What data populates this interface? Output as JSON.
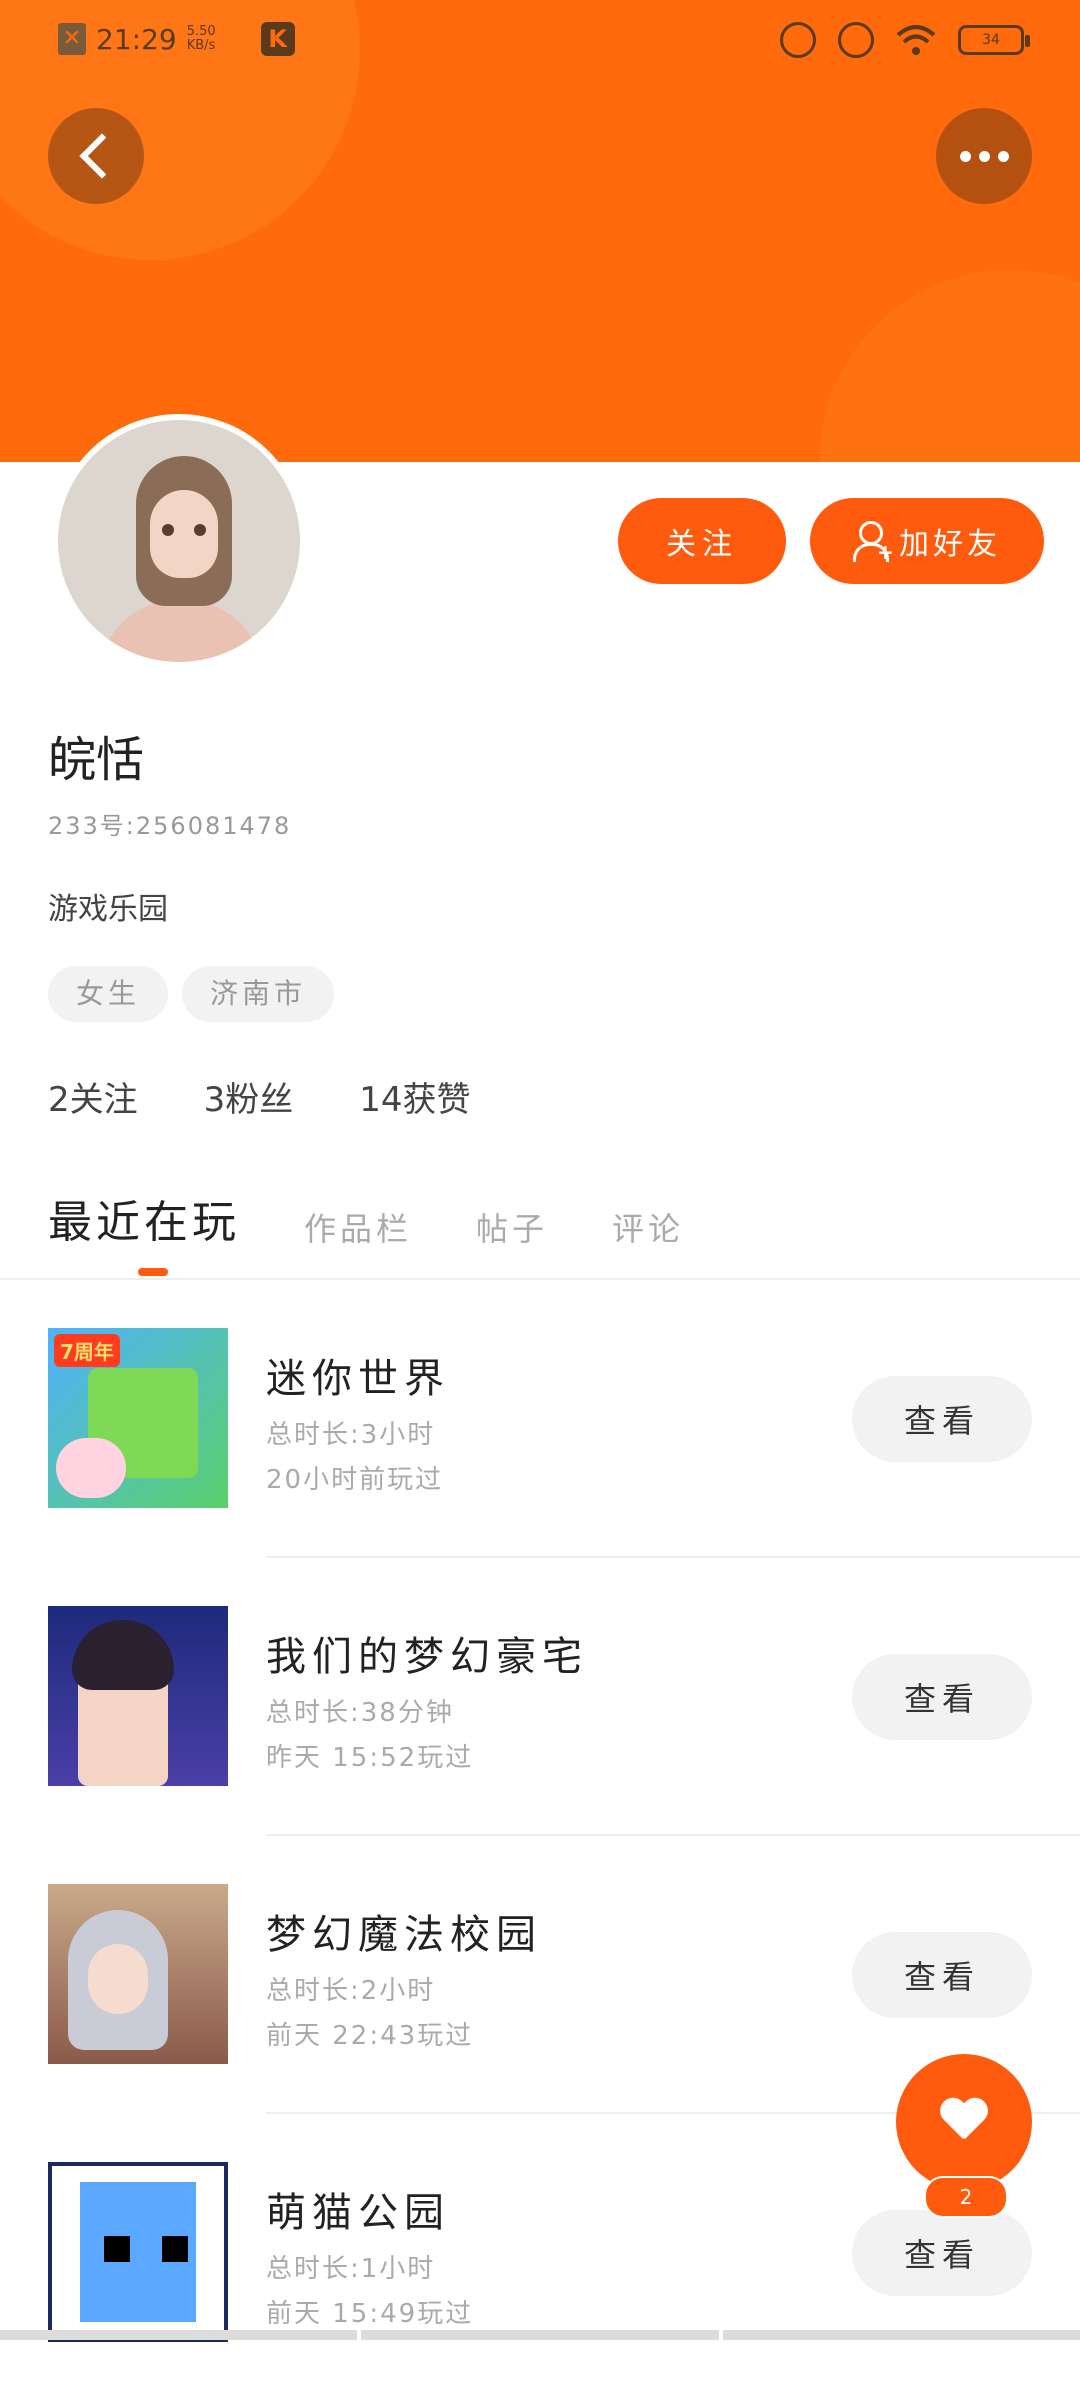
{
  "statusbar": {
    "time": "21:29",
    "speed": "5.50 KB/s",
    "battery": "34"
  },
  "profile": {
    "name": "皖恬",
    "uid": "233号:256081478",
    "bio": "游戏乐园",
    "tags": [
      "女生",
      "济南市"
    ],
    "stats": {
      "following": "2关注",
      "fans": "3粉丝",
      "likes": "14获赞"
    }
  },
  "actions": {
    "follow": "关注",
    "add_friend": "加好友"
  },
  "tabs": [
    "最近在玩",
    "作品栏",
    "帖子",
    "评论"
  ],
  "games": [
    {
      "name": "迷你世界",
      "duration": "总时长:3小时",
      "last_played": "20小时前玩过",
      "button": "查看"
    },
    {
      "name": "我们的梦幻豪宅",
      "duration": "总时长:38分钟",
      "last_played": "昨天 15:52玩过",
      "button": "查看"
    },
    {
      "name": "梦幻魔法校园",
      "duration": "总时长:2小时",
      "last_played": "前天 22:43玩过",
      "button": "查看"
    },
    {
      "name": "萌猫公园",
      "duration": "总时长:1小时",
      "last_played": "前天 15:49玩过",
      "button": "查看"
    }
  ],
  "thumb_badge": "7周年",
  "fab": {
    "count": "2"
  },
  "colors": {
    "accent": "#ff5b0f",
    "header": "#ff6a0d"
  }
}
